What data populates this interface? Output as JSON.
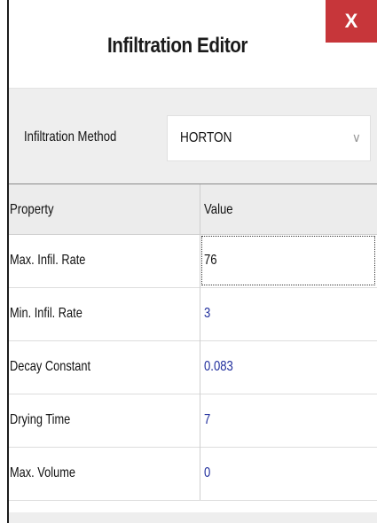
{
  "window": {
    "title": "Infiltration Editor",
    "close_label": "X"
  },
  "method": {
    "label": "Infiltration Method",
    "selected": "HORTON"
  },
  "grid": {
    "headers": {
      "property": "Property",
      "value": "Value"
    },
    "rows": [
      {
        "property": "Max. Infil. Rate",
        "value": "76"
      },
      {
        "property": "Min. Infil. Rate",
        "value": "3"
      },
      {
        "property": "Decay Constant",
        "value": "0.083"
      },
      {
        "property": "Drying Time",
        "value": "7"
      },
      {
        "property": "Max. Volume",
        "value": "0"
      }
    ]
  },
  "colors": {
    "close_button": "#c7363a",
    "value_text": "#1f2d9c",
    "panel_background": "#eeeeee"
  },
  "icons": {
    "close": "close-icon",
    "dropdown": "chevron-down-icon"
  }
}
